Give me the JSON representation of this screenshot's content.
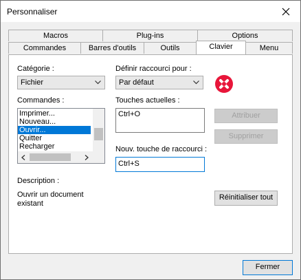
{
  "window": {
    "title": "Personnaliser"
  },
  "tabs_top": [
    "Macros",
    "Plug-ins",
    "Options"
  ],
  "tabs_bottom": [
    "Commandes",
    "Barres d'outils",
    "Outils",
    "Clavier",
    "Menu"
  ],
  "active_tab": "Clavier",
  "category": {
    "label": "Catégorie :",
    "value": "Fichier"
  },
  "shortcut_for": {
    "label": "Définir raccourci pour :",
    "value": "Par défaut"
  },
  "commands": {
    "label": "Commandes :",
    "items": [
      "Imprimer...",
      "Nouveau...",
      "Ouvrir...",
      "Quitter",
      "Recharger"
    ],
    "selected": "Ouvrir..."
  },
  "current_keys": {
    "label": "Touches actuelles :",
    "value": "Ctrl+O"
  },
  "new_key": {
    "label": "Nouv. touche de raccourci :",
    "value": "Ctrl+S"
  },
  "buttons": {
    "assign": "Attribuer",
    "remove": "Supprimer",
    "reset_all": "Réinitialiser tout",
    "close": "Fermer"
  },
  "description": {
    "label": "Description :",
    "text": "Ouvrir un document existant"
  },
  "colors": {
    "accent": "#0078d7",
    "brand_icon": "#e8163a"
  },
  "icons": {
    "close": "close-icon",
    "brand": "xmlspy-logo-icon"
  }
}
